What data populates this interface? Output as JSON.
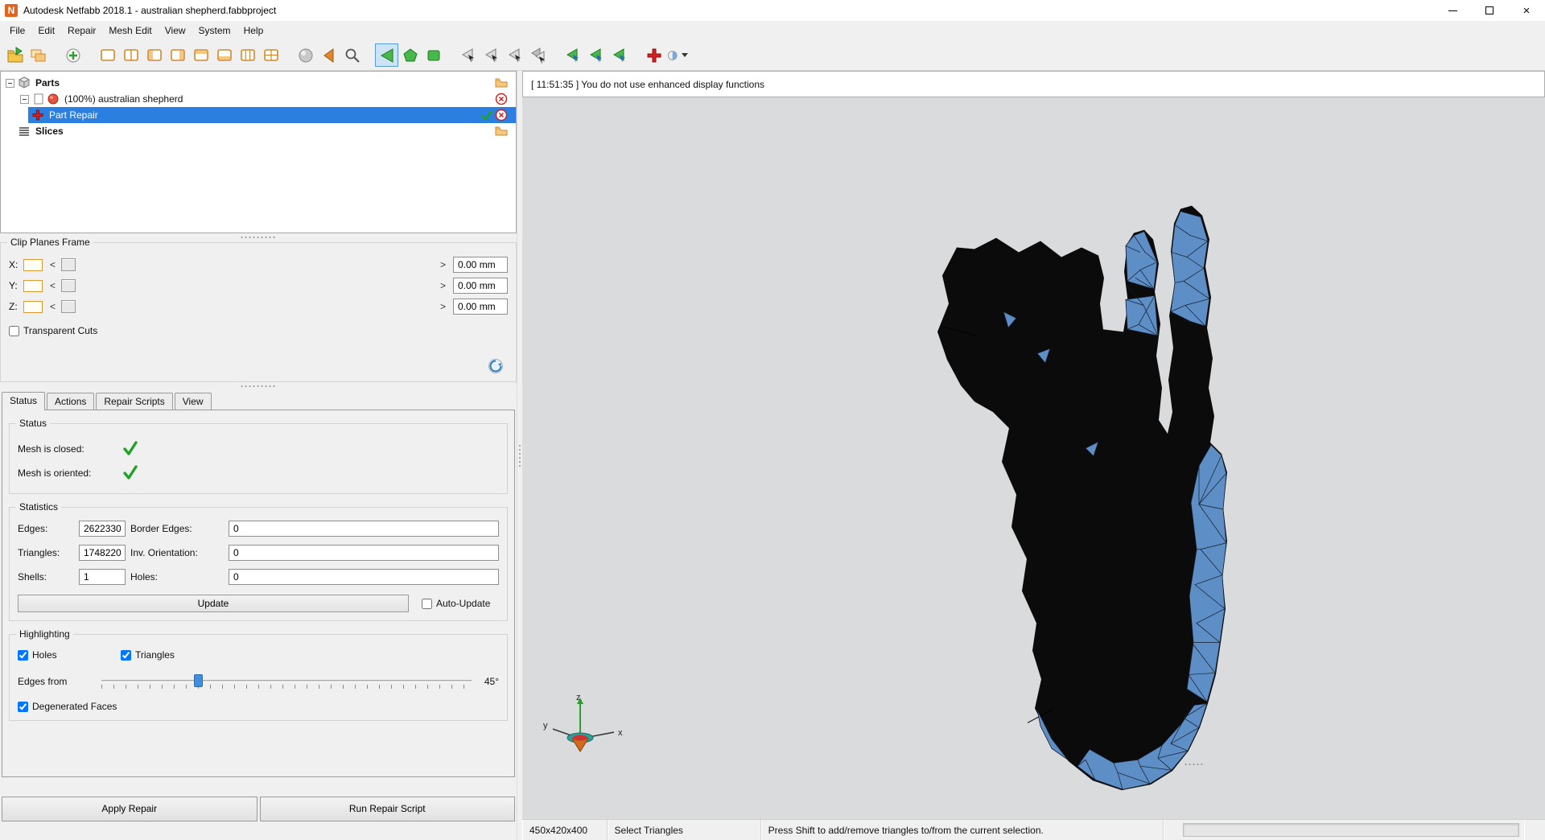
{
  "titlebar": {
    "title": "Autodesk Netfabb 2018.1 - australian shepherd.fabbproject",
    "app_letter": "N"
  },
  "menu": {
    "items": [
      "File",
      "Edit",
      "Repair",
      "Mesh Edit",
      "View",
      "System",
      "Help"
    ]
  },
  "toolbar": {
    "tools": [
      "open-project",
      "import-parts",
      "add-part",
      "layout-single",
      "layout-split",
      "layout-left-pane",
      "layout-right-pane",
      "layout-top-pane",
      "layout-bottom-pane",
      "layout-columns",
      "layout-grid",
      "shaded-view",
      "previous-view",
      "zoom",
      "select-triangles",
      "select-polygon",
      "select-rectangle",
      "pick-triangle",
      "pick-triangle-2",
      "pick-triangle-3",
      "pick-shell",
      "select-connected",
      "select-plane",
      "select-all",
      "add-triangles",
      "surface-picker"
    ]
  },
  "tree": {
    "root": "Parts",
    "part": "(100%) australian shepherd",
    "repair": "Part Repair",
    "slices": "Slices"
  },
  "clip": {
    "title": "Clip Planes Frame",
    "x_label": "X:",
    "y_label": "Y:",
    "z_label": "Z:",
    "x_value": "0.00 mm",
    "y_value": "0.00 mm",
    "z_value": "0.00 mm",
    "left_arrow": "<",
    "right_arrow": ">",
    "transparent_cuts": "Transparent Cuts",
    "transparent_cuts_checked": false
  },
  "tabs": {
    "status": "Status",
    "actions": "Actions",
    "repair_scripts": "Repair Scripts",
    "view": "View"
  },
  "status_group": {
    "title": "Status",
    "closed_label": "Mesh is closed:",
    "oriented_label": "Mesh is oriented:"
  },
  "statistics": {
    "title": "Statistics",
    "edges_label": "Edges:",
    "edges_value": "2622330",
    "border_edges_label": "Border Edges:",
    "border_edges_value": "0",
    "triangles_label": "Triangles:",
    "triangles_value": "1748220",
    "inv_orientation_label": "Inv. Orientation:",
    "inv_orientation_value": "0",
    "shells_label": "Shells:",
    "shells_value": "1",
    "holes_label": "Holes:",
    "holes_value": "0",
    "update_button": "Update",
    "auto_update": "Auto-Update",
    "auto_update_checked": false
  },
  "highlighting": {
    "title": "Highlighting",
    "holes": "Holes",
    "holes_checked": true,
    "triangles": "Triangles",
    "triangles_checked": true,
    "edges_from": "Edges from",
    "angle": "45°",
    "degenerated": "Degenerated Faces",
    "degenerated_checked": true
  },
  "bottom": {
    "apply": "Apply Repair",
    "run_script": "Run Repair Script"
  },
  "viewport": {
    "message": "[ 11:51:35 ] You do not use enhanced display functions",
    "axis_x": "x",
    "axis_y": "y",
    "axis_z": "z"
  },
  "statusbar": {
    "dimensions": "450x420x400",
    "mode": "Select Triangles",
    "hint": "Press Shift to add/remove triangles to/from the current selection."
  },
  "colors": {
    "selection_blue": "#2a7fe0",
    "mesh_blue": "#5d8ec6",
    "model_black": "#0b0b0b",
    "check_green": "#23a127",
    "accent_orange": "#dd9933"
  }
}
